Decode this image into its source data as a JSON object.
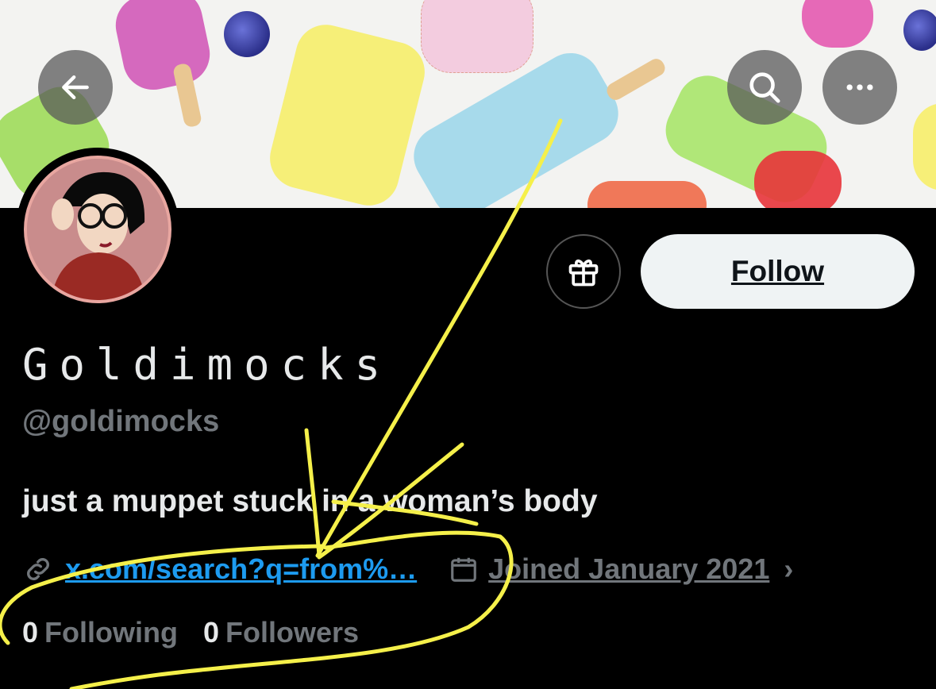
{
  "profile": {
    "display_name": "Goldimocks",
    "handle": "@goldimocks",
    "bio": "just a muppet stuck in a woman’s body",
    "link": "x.com/search?q=from%…",
    "joined": "Joined January 2021",
    "following_count": "0",
    "following_label": "Following",
    "followers_count": "0",
    "followers_label": "Followers"
  },
  "actions": {
    "follow_label": "Follow"
  },
  "icons": {
    "back": "arrow-left-icon",
    "search": "search-icon",
    "more": "more-horizontal-icon",
    "gift": "gift-icon",
    "link": "link-icon",
    "calendar": "calendar-icon",
    "chevron": "chevron-right-icon"
  },
  "colors": {
    "accent_link": "#1d9bf0",
    "muted_text": "#71767b",
    "annotation": "#f5f04a"
  }
}
